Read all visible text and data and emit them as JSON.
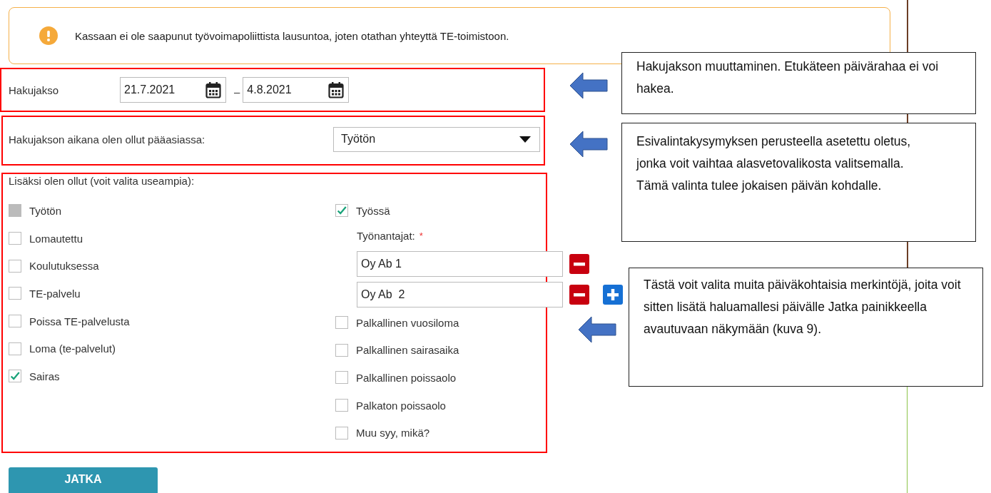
{
  "alert": {
    "text": "Kassaan ei ole saapunut työvoimapoliittista lausuntoa, joten otathan yhteyttä TE-toimistoon."
  },
  "period": {
    "label": "Hakujakso",
    "start": "21.7.2021",
    "separator": "–",
    "end": "4.8.2021"
  },
  "main_status": {
    "label": "Hakujakson aikana olen ollut pääasiassa:",
    "value": "Työtön"
  },
  "additional": {
    "label": "Lisäksi olen ollut (voit valita useampia):",
    "left_options": [
      {
        "label": "Työtön",
        "checked": false,
        "disabled": true
      },
      {
        "label": "Lomautettu",
        "checked": false,
        "disabled": false
      },
      {
        "label": "Koulutuksessa",
        "checked": false,
        "disabled": false
      },
      {
        "label": "TE-palvelu",
        "checked": false,
        "disabled": false
      },
      {
        "label": "Poissa TE-palvelusta",
        "checked": false,
        "disabled": false
      },
      {
        "label": "Loma (te-palvelut)",
        "checked": false,
        "disabled": false
      },
      {
        "label": "Sairas",
        "checked": true,
        "disabled": false
      }
    ],
    "right_column": [
      {
        "kind": "checkbox",
        "label": "Työssä",
        "checked": true,
        "disabled": false
      },
      {
        "kind": "employers",
        "label": "Työnantajat:",
        "required_mark": "*",
        "add_button": true,
        "entries": [
          {
            "value": "Oy Ab 1"
          },
          {
            "value": "Oy Ab  2"
          }
        ]
      },
      {
        "kind": "checkbox",
        "label": "Palkallinen vuosiloma",
        "checked": false,
        "disabled": false
      },
      {
        "kind": "checkbox",
        "label": "Palkallinen sairasaika",
        "checked": false,
        "disabled": false
      },
      {
        "kind": "checkbox",
        "label": "Palkallinen poissaolo",
        "checked": false,
        "disabled": false
      },
      {
        "kind": "checkbox",
        "label": "Palkaton poissaolo",
        "checked": false,
        "disabled": false
      },
      {
        "kind": "checkbox",
        "label": "Muu syy, mikä?",
        "checked": false,
        "disabled": false
      }
    ]
  },
  "button": "JATKA",
  "callouts": [
    {
      "text": "Hakujakson muuttaminen. Etukäteen päivärahaa ei voi hakea."
    },
    {
      "text": "Esivalintakysymyksen perusteella asetettu oletus, jonka voit vaihtaa alasvetovalikosta valitsemalla. Tämä valinta tulee jokaisen päivän kohdalle."
    },
    {
      "text": "Tästä voit valita muita päiväkohtaisia merkintöjä, joita voit sitten lisätä haluamallesi päivälle Jatka painikkeella avautuvaan näkymään (kuva 9)."
    }
  ]
}
